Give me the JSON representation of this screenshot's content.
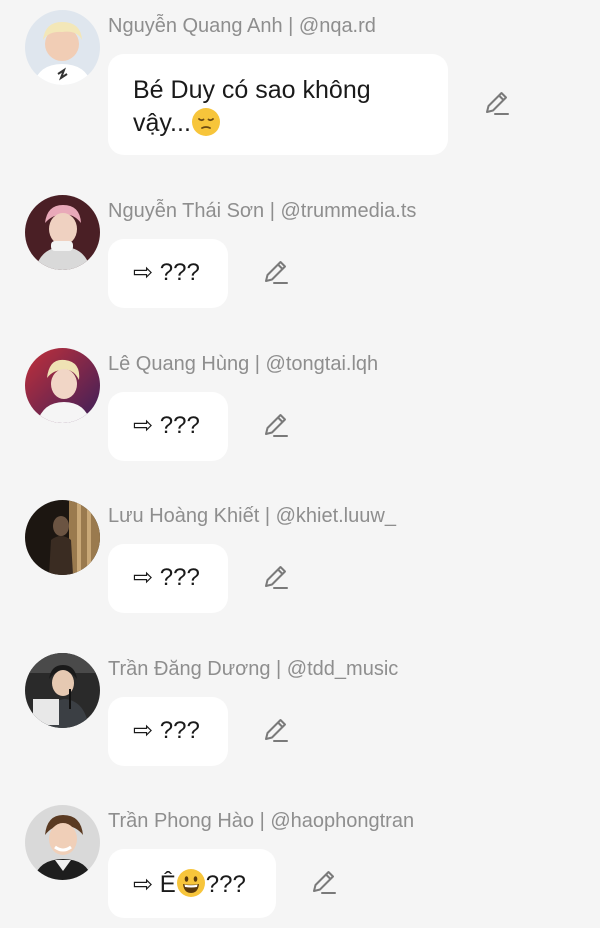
{
  "messages": [
    {
      "sender": "Nguyễn Quang Anh | @nqa.rd",
      "text_line1": "Bé Duy có sao không",
      "text_line2": "vậy...",
      "emoji": "pensive-face-emoji"
    },
    {
      "sender": "Nguyễn Thái Sơn | @trummedia.ts",
      "text": "⇨ ???"
    },
    {
      "sender": "Lê Quang Hùng | @tongtai.lqh",
      "text": "⇨ ???"
    },
    {
      "sender": "Lưu Hoàng Khiết | @khiet.luuw_",
      "text": "⇨ ???"
    },
    {
      "sender": "Trần Đăng Dương | @tdd_music",
      "text": "⇨ ???"
    },
    {
      "sender": "Trần Phong Hào | @haophongtran",
      "text_before": "⇨ Ê",
      "text_after": "???",
      "emoji": "grinning-face-emoji"
    }
  ],
  "icons": {
    "edit": "pencil-edit-icon"
  },
  "colors": {
    "background": "#f5f5f5",
    "bubble": "#ffffff",
    "sender_text": "#8e8e8e",
    "message_text": "#1a1a1a",
    "icon": "#7a7a7a"
  }
}
